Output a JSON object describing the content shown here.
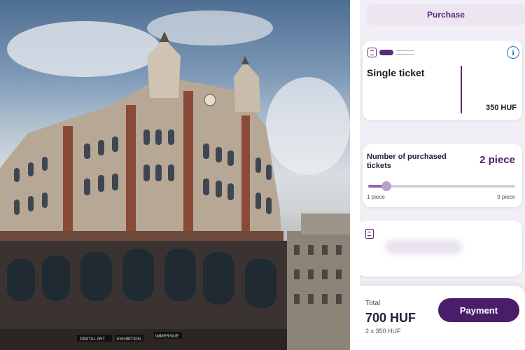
{
  "header": {
    "title": "Purchase"
  },
  "ticket": {
    "name": "Single ticket",
    "price": "350 HUF",
    "info_icon": "i"
  },
  "quantity": {
    "label": "Number of purchased tickets",
    "count": "2 piece",
    "min_label": "1 piece",
    "max_label": "9 piece",
    "value": 2,
    "min": 1,
    "max": 9
  },
  "footer": {
    "total_label": "Total",
    "total": "700 HUF",
    "calculation": "2 x 350 HUF",
    "payment_label": "Payment"
  },
  "photo_signs": {
    "sign1": "EXHIBITION",
    "sign2": "DIGITAL ART",
    "sign3": "IMMERSIVE"
  },
  "colors": {
    "accent": "#4a1d6b",
    "info": "#2b73c7",
    "background": "#f1eef5"
  }
}
